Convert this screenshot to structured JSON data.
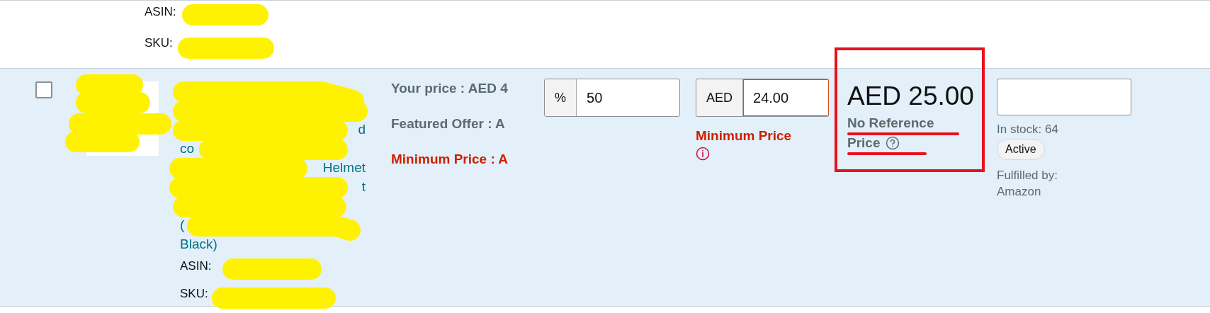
{
  "top_row": {
    "asin_label": "ASIN:",
    "sku_label": "SKU:"
  },
  "product": {
    "checked": false,
    "title_lines": [
      {
        "kind": "covered"
      },
      {
        "kind": "covered"
      },
      {
        "kind": "text",
        "end": "d"
      },
      {
        "kind": "text",
        "start": "co"
      },
      {
        "kind": "text",
        "end": "Helmet"
      },
      {
        "kind": "text",
        "end": "t"
      },
      {
        "kind": "covered"
      },
      {
        "kind": "text",
        "start": "("
      },
      {
        "kind": "text",
        "start": "Black)"
      }
    ],
    "asin_label": "ASIN:",
    "sku_label": "SKU:",
    "your_price": "Your price : AED 4",
    "featured_offer": "Featured Offer : A",
    "minimum_price": "Minimum Price : A",
    "percent_field": {
      "prefix": "%",
      "value": "50",
      "error": false
    },
    "price_field": {
      "prefix": "AED",
      "value": "24.00",
      "error": true
    },
    "price_warning": "Minimum Price",
    "reference": {
      "price": "AED 25.00",
      "label_lines": [
        "No Reference",
        "Price"
      ]
    },
    "in_stock": "In stock: 64",
    "status": "Active",
    "fulfilled_by_lines": [
      "Fulfilled by:",
      "Amazon"
    ]
  }
}
